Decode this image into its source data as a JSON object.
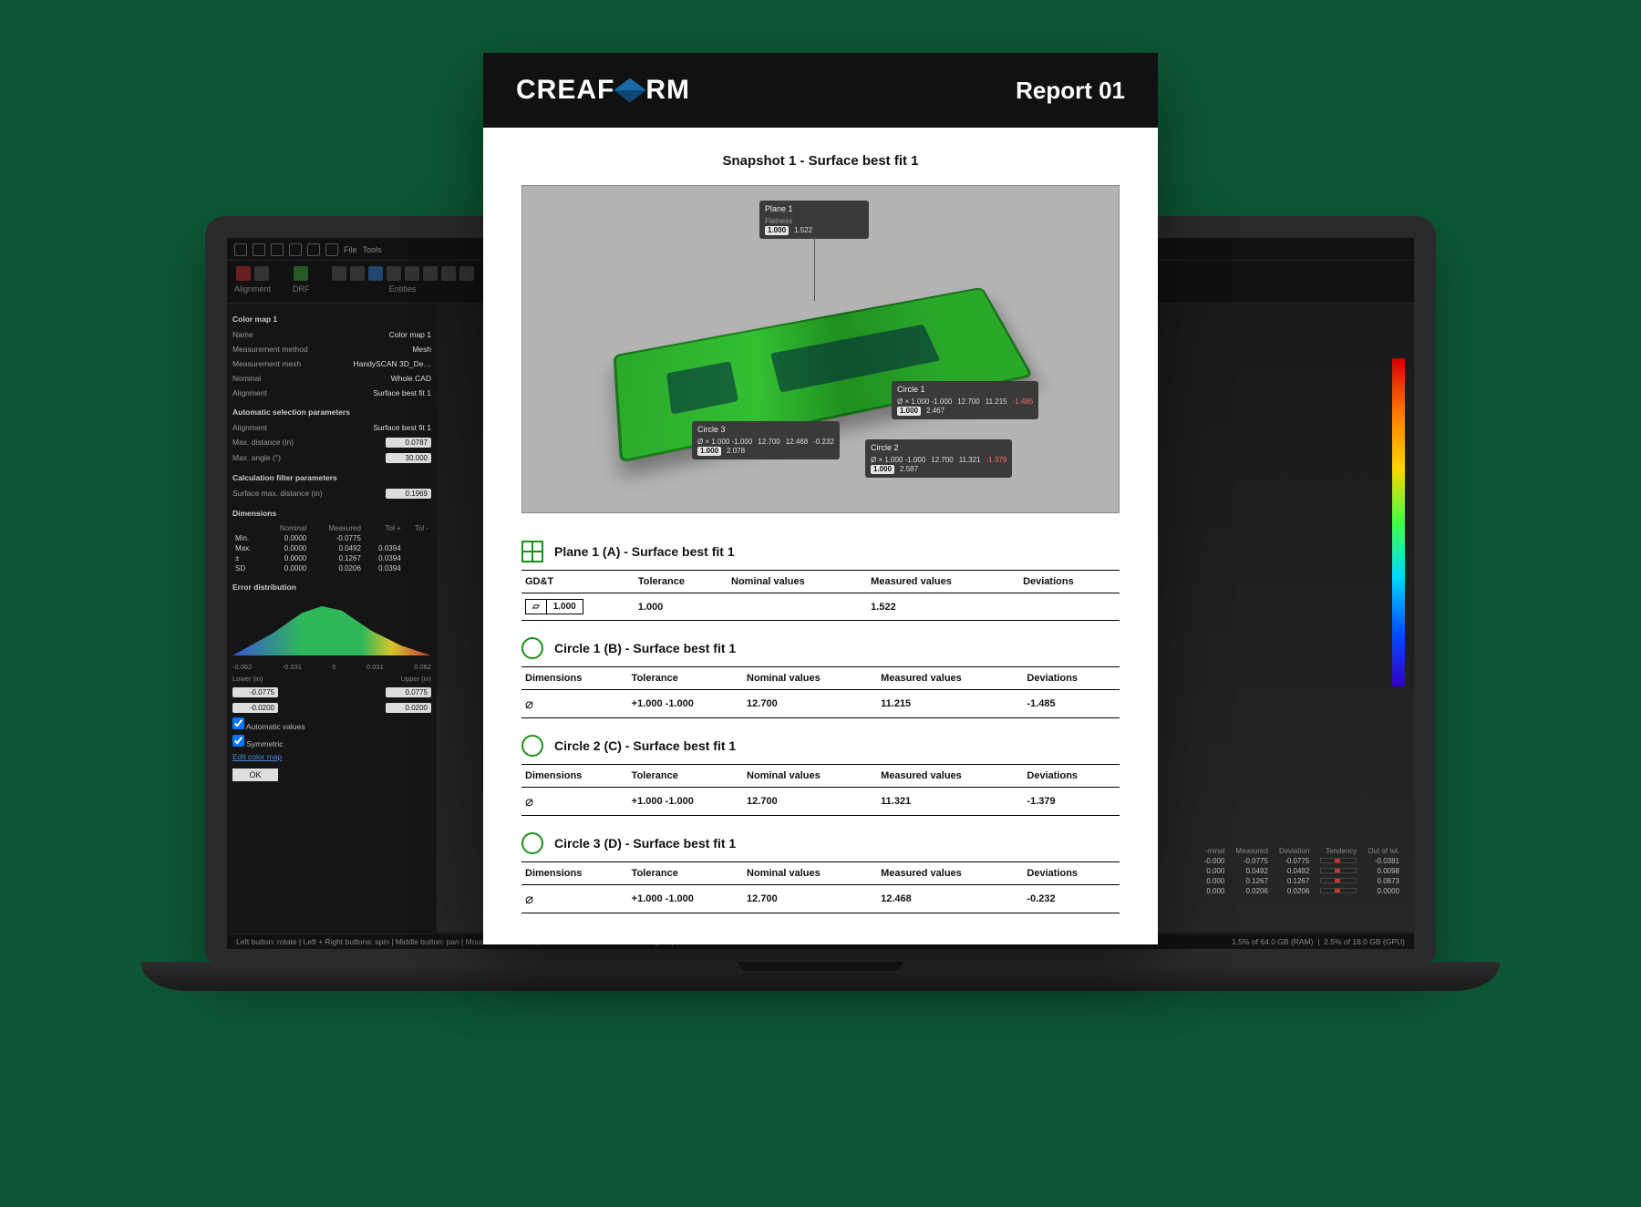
{
  "app": {
    "menu": [
      "File",
      "Tools"
    ],
    "ribbon": {
      "groups": [
        {
          "label": "Alignment"
        },
        {
          "label": "DRF"
        },
        {
          "label": "Entities"
        }
      ]
    },
    "panel": {
      "title": "Color map 1",
      "props": {
        "name_k": "Name",
        "name_v": "Color map 1",
        "method_k": "Measurement method",
        "method_v": "Mesh",
        "mesh_k": "Measurement mesh",
        "mesh_v": "HandySCAN 3D_De…",
        "nominal_k": "Nominal",
        "nominal_v": "Whole CAD",
        "align_k": "Alignment",
        "align_v": "Surface best fit 1"
      },
      "auto_title": "Automatic selection parameters",
      "auto": {
        "align_k": "Alignment",
        "align_v": "Surface best fit 1",
        "maxd_k": "Max. distance (in)",
        "maxd_v": "0.0787",
        "maxa_k": "Max. angle (°)",
        "maxa_v": "30.000"
      },
      "calc_title": "Calculation filter parameters",
      "calc": {
        "smd_k": "Surface max. distance (in)",
        "smd_v": "0.1969"
      },
      "dim_title": "Dimensions",
      "dim_cols": [
        "",
        "Nominal",
        "Measured",
        "Tol +",
        "Tol -"
      ],
      "dim_rows": [
        {
          "k": "Min.",
          "n": "0.0000",
          "m": "-0.0775",
          "tp": "",
          "tn": ""
        },
        {
          "k": "Max.",
          "n": "0.0000",
          "m": "0.0492",
          "tp": "0.0394",
          "tn": ""
        },
        {
          "k": "±",
          "n": "0.0000",
          "m": "0.1267",
          "tp": "0.0394",
          "tn": ""
        },
        {
          "k": "SD",
          "n": "0.0000",
          "m": "0.0206",
          "tp": "0.0394",
          "tn": ""
        }
      ],
      "err_title": "Error distribution",
      "scale_lo": "-0.062",
      "scale_mid1": "-0.031",
      "scale_mid2": "0.031",
      "scale_hi": "0.062",
      "lower_lbl": "Lower (in)",
      "upper_lbl": "Upper (in)",
      "lower1": "-0.0775",
      "upper1": "0.0775",
      "lower2": "-0.0200",
      "upper2": "0.0200",
      "auto_vals": "Automatic values",
      "symmetric": "Symmetric",
      "edit_cm": "Edit color map",
      "ok": "OK"
    },
    "results": {
      "cols": [
        "-minal",
        "Measured",
        "Deviation",
        "Tendency",
        "Out of tol."
      ],
      "rows": [
        {
          "n": "-0.000",
          "m": "-0.0775",
          "d": "-0.0775",
          "o": "-0.0381"
        },
        {
          "n": "0.000",
          "m": "0.0492",
          "d": "0.0492",
          "o": "0.0098"
        },
        {
          "n": "0.000",
          "m": "0.1267",
          "d": "0.1267",
          "o": "0.0873"
        },
        {
          "n": "0.000",
          "m": "0.0206",
          "d": "0.0206",
          "o": "0.0000"
        }
      ]
    },
    "status_hints": "Left button: rotate | Left + Right buttons: spin | Middle button: pan | Mouse wheel: zoom | Shift + Middle button: zoom on region | Hold Ctrl: start selection",
    "status_ram": "1.5% of 64.0 GB (RAM)",
    "status_gpu": "2.5% of 18.0 GB (GPU)"
  },
  "report": {
    "brand_a": "CREAF",
    "brand_b": "RM",
    "title": "Report 01",
    "snapshot_title": "Snapshot 1 - Surface best fit 1",
    "callouts": {
      "plane1": {
        "title": "Plane 1",
        "sub": "Flatness",
        "box": "1.000",
        "val": "1.522"
      },
      "circ1": {
        "title": "Circle 1",
        "dim": "Ø × 1.000 -1.000",
        "n": "12.700",
        "m": "11.215",
        "d": "-1.485",
        "b": "1.000",
        "v": "2.467"
      },
      "circ2": {
        "title": "Circle 2",
        "dim": "Ø × 1.000 -1.000",
        "n": "12.700",
        "m": "11.321",
        "d": "-1.379",
        "b": "1.000",
        "v": "2.587"
      },
      "circ3": {
        "title": "Circle 3",
        "dim": "Ø × 1.000 -1.000",
        "n": "12.700",
        "m": "12.468",
        "d": "-0.232",
        "b": "1.000",
        "v": "2.078"
      }
    },
    "cols": {
      "gdandt": "GD&T",
      "dims": "Dimensions",
      "tol": "Tolerance",
      "nom": "Nominal values",
      "meas": "Measured values",
      "dev": "Deviations"
    },
    "sections": [
      {
        "icon": "grid",
        "title": "Plane 1 (A) - Surface best fit 1",
        "type": "gdandt",
        "sym": "▱",
        "box": "1.000",
        "tol": "1.000",
        "nom": "",
        "meas": "1.522",
        "dev": ""
      },
      {
        "icon": "circle",
        "title": "Circle 1 (B) - Surface best fit 1",
        "type": "dim",
        "tol": "+1.000 -1.000",
        "nom": "12.700",
        "meas": "11.215",
        "dev": "-1.485"
      },
      {
        "icon": "circle",
        "title": "Circle 2 (C) - Surface best fit 1",
        "type": "dim",
        "tol": "+1.000 -1.000",
        "nom": "12.700",
        "meas": "11.321",
        "dev": "-1.379"
      },
      {
        "icon": "circle",
        "title": "Circle 3 (D) - Surface best fit 1",
        "type": "dim",
        "tol": "+1.000 -1.000",
        "nom": "12.700",
        "meas": "12.468",
        "dev": "-0.232"
      }
    ]
  }
}
